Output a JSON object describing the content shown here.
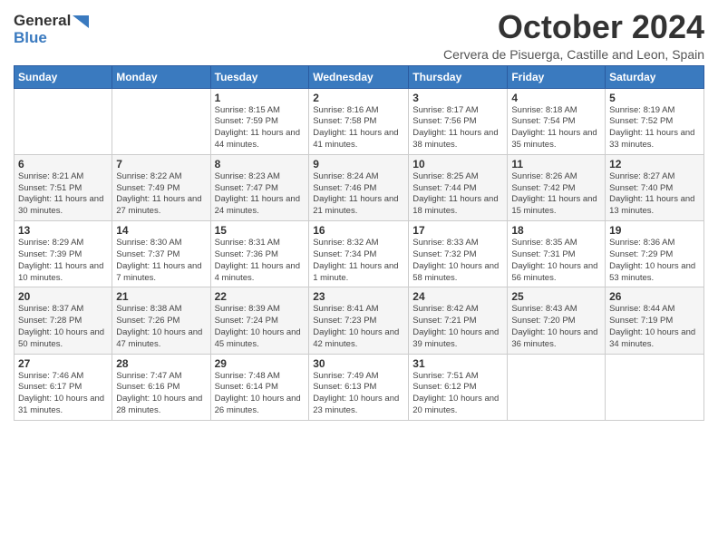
{
  "header": {
    "logo_general": "General",
    "logo_blue": "Blue",
    "title": "October 2024",
    "subtitle": "Cervera de Pisuerga, Castille and Leon, Spain"
  },
  "calendar": {
    "days_of_week": [
      "Sunday",
      "Monday",
      "Tuesday",
      "Wednesday",
      "Thursday",
      "Friday",
      "Saturday"
    ],
    "weeks": [
      [
        {
          "day": "",
          "info": ""
        },
        {
          "day": "",
          "info": ""
        },
        {
          "day": "1",
          "info": "Sunrise: 8:15 AM\nSunset: 7:59 PM\nDaylight: 11 hours and 44 minutes."
        },
        {
          "day": "2",
          "info": "Sunrise: 8:16 AM\nSunset: 7:58 PM\nDaylight: 11 hours and 41 minutes."
        },
        {
          "day": "3",
          "info": "Sunrise: 8:17 AM\nSunset: 7:56 PM\nDaylight: 11 hours and 38 minutes."
        },
        {
          "day": "4",
          "info": "Sunrise: 8:18 AM\nSunset: 7:54 PM\nDaylight: 11 hours and 35 minutes."
        },
        {
          "day": "5",
          "info": "Sunrise: 8:19 AM\nSunset: 7:52 PM\nDaylight: 11 hours and 33 minutes."
        }
      ],
      [
        {
          "day": "6",
          "info": "Sunrise: 8:21 AM\nSunset: 7:51 PM\nDaylight: 11 hours and 30 minutes."
        },
        {
          "day": "7",
          "info": "Sunrise: 8:22 AM\nSunset: 7:49 PM\nDaylight: 11 hours and 27 minutes."
        },
        {
          "day": "8",
          "info": "Sunrise: 8:23 AM\nSunset: 7:47 PM\nDaylight: 11 hours and 24 minutes."
        },
        {
          "day": "9",
          "info": "Sunrise: 8:24 AM\nSunset: 7:46 PM\nDaylight: 11 hours and 21 minutes."
        },
        {
          "day": "10",
          "info": "Sunrise: 8:25 AM\nSunset: 7:44 PM\nDaylight: 11 hours and 18 minutes."
        },
        {
          "day": "11",
          "info": "Sunrise: 8:26 AM\nSunset: 7:42 PM\nDaylight: 11 hours and 15 minutes."
        },
        {
          "day": "12",
          "info": "Sunrise: 8:27 AM\nSunset: 7:40 PM\nDaylight: 11 hours and 13 minutes."
        }
      ],
      [
        {
          "day": "13",
          "info": "Sunrise: 8:29 AM\nSunset: 7:39 PM\nDaylight: 11 hours and 10 minutes."
        },
        {
          "day": "14",
          "info": "Sunrise: 8:30 AM\nSunset: 7:37 PM\nDaylight: 11 hours and 7 minutes."
        },
        {
          "day": "15",
          "info": "Sunrise: 8:31 AM\nSunset: 7:36 PM\nDaylight: 11 hours and 4 minutes."
        },
        {
          "day": "16",
          "info": "Sunrise: 8:32 AM\nSunset: 7:34 PM\nDaylight: 11 hours and 1 minute."
        },
        {
          "day": "17",
          "info": "Sunrise: 8:33 AM\nSunset: 7:32 PM\nDaylight: 10 hours and 58 minutes."
        },
        {
          "day": "18",
          "info": "Sunrise: 8:35 AM\nSunset: 7:31 PM\nDaylight: 10 hours and 56 minutes."
        },
        {
          "day": "19",
          "info": "Sunrise: 8:36 AM\nSunset: 7:29 PM\nDaylight: 10 hours and 53 minutes."
        }
      ],
      [
        {
          "day": "20",
          "info": "Sunrise: 8:37 AM\nSunset: 7:28 PM\nDaylight: 10 hours and 50 minutes."
        },
        {
          "day": "21",
          "info": "Sunrise: 8:38 AM\nSunset: 7:26 PM\nDaylight: 10 hours and 47 minutes."
        },
        {
          "day": "22",
          "info": "Sunrise: 8:39 AM\nSunset: 7:24 PM\nDaylight: 10 hours and 45 minutes."
        },
        {
          "day": "23",
          "info": "Sunrise: 8:41 AM\nSunset: 7:23 PM\nDaylight: 10 hours and 42 minutes."
        },
        {
          "day": "24",
          "info": "Sunrise: 8:42 AM\nSunset: 7:21 PM\nDaylight: 10 hours and 39 minutes."
        },
        {
          "day": "25",
          "info": "Sunrise: 8:43 AM\nSunset: 7:20 PM\nDaylight: 10 hours and 36 minutes."
        },
        {
          "day": "26",
          "info": "Sunrise: 8:44 AM\nSunset: 7:19 PM\nDaylight: 10 hours and 34 minutes."
        }
      ],
      [
        {
          "day": "27",
          "info": "Sunrise: 7:46 AM\nSunset: 6:17 PM\nDaylight: 10 hours and 31 minutes."
        },
        {
          "day": "28",
          "info": "Sunrise: 7:47 AM\nSunset: 6:16 PM\nDaylight: 10 hours and 28 minutes."
        },
        {
          "day": "29",
          "info": "Sunrise: 7:48 AM\nSunset: 6:14 PM\nDaylight: 10 hours and 26 minutes."
        },
        {
          "day": "30",
          "info": "Sunrise: 7:49 AM\nSunset: 6:13 PM\nDaylight: 10 hours and 23 minutes."
        },
        {
          "day": "31",
          "info": "Sunrise: 7:51 AM\nSunset: 6:12 PM\nDaylight: 10 hours and 20 minutes."
        },
        {
          "day": "",
          "info": ""
        },
        {
          "day": "",
          "info": ""
        }
      ]
    ]
  }
}
